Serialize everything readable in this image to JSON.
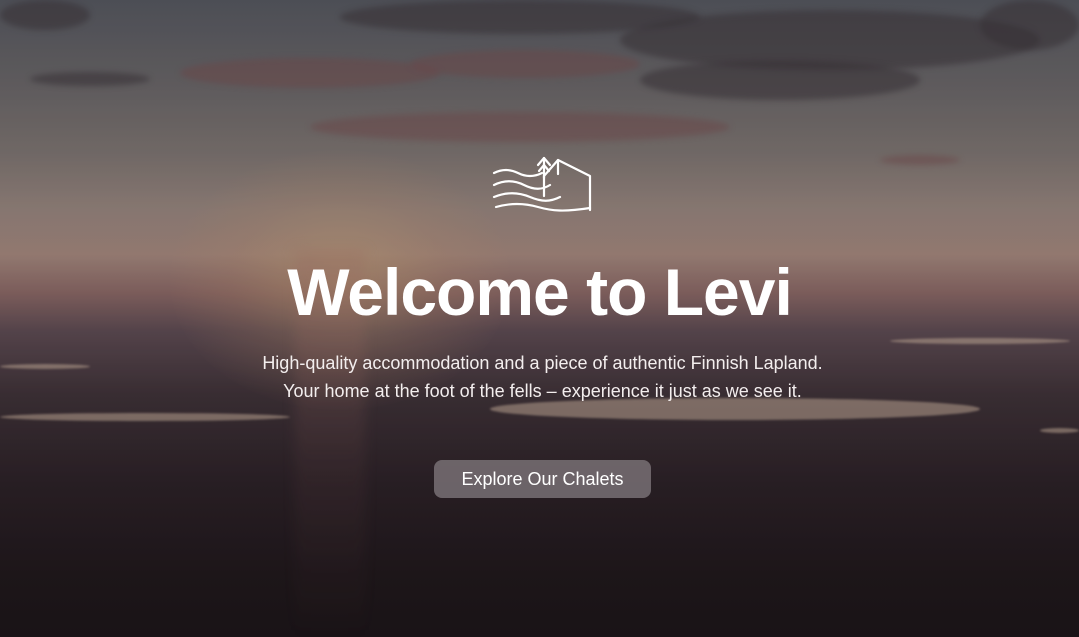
{
  "hero": {
    "title": "Welcome to Levi",
    "subtitle": "High-quality accommodation and a piece of authentic Finnish Lapland. Your home at the foot of the fells – experience it just as we see it.",
    "cta_label": "Explore Our Chalets",
    "logo_icon": "chalet-waves-logo-icon",
    "background": "sunset-over-lapland-landscape",
    "colors": {
      "text": "#ffffff",
      "button_bg": "#78706f"
    }
  }
}
